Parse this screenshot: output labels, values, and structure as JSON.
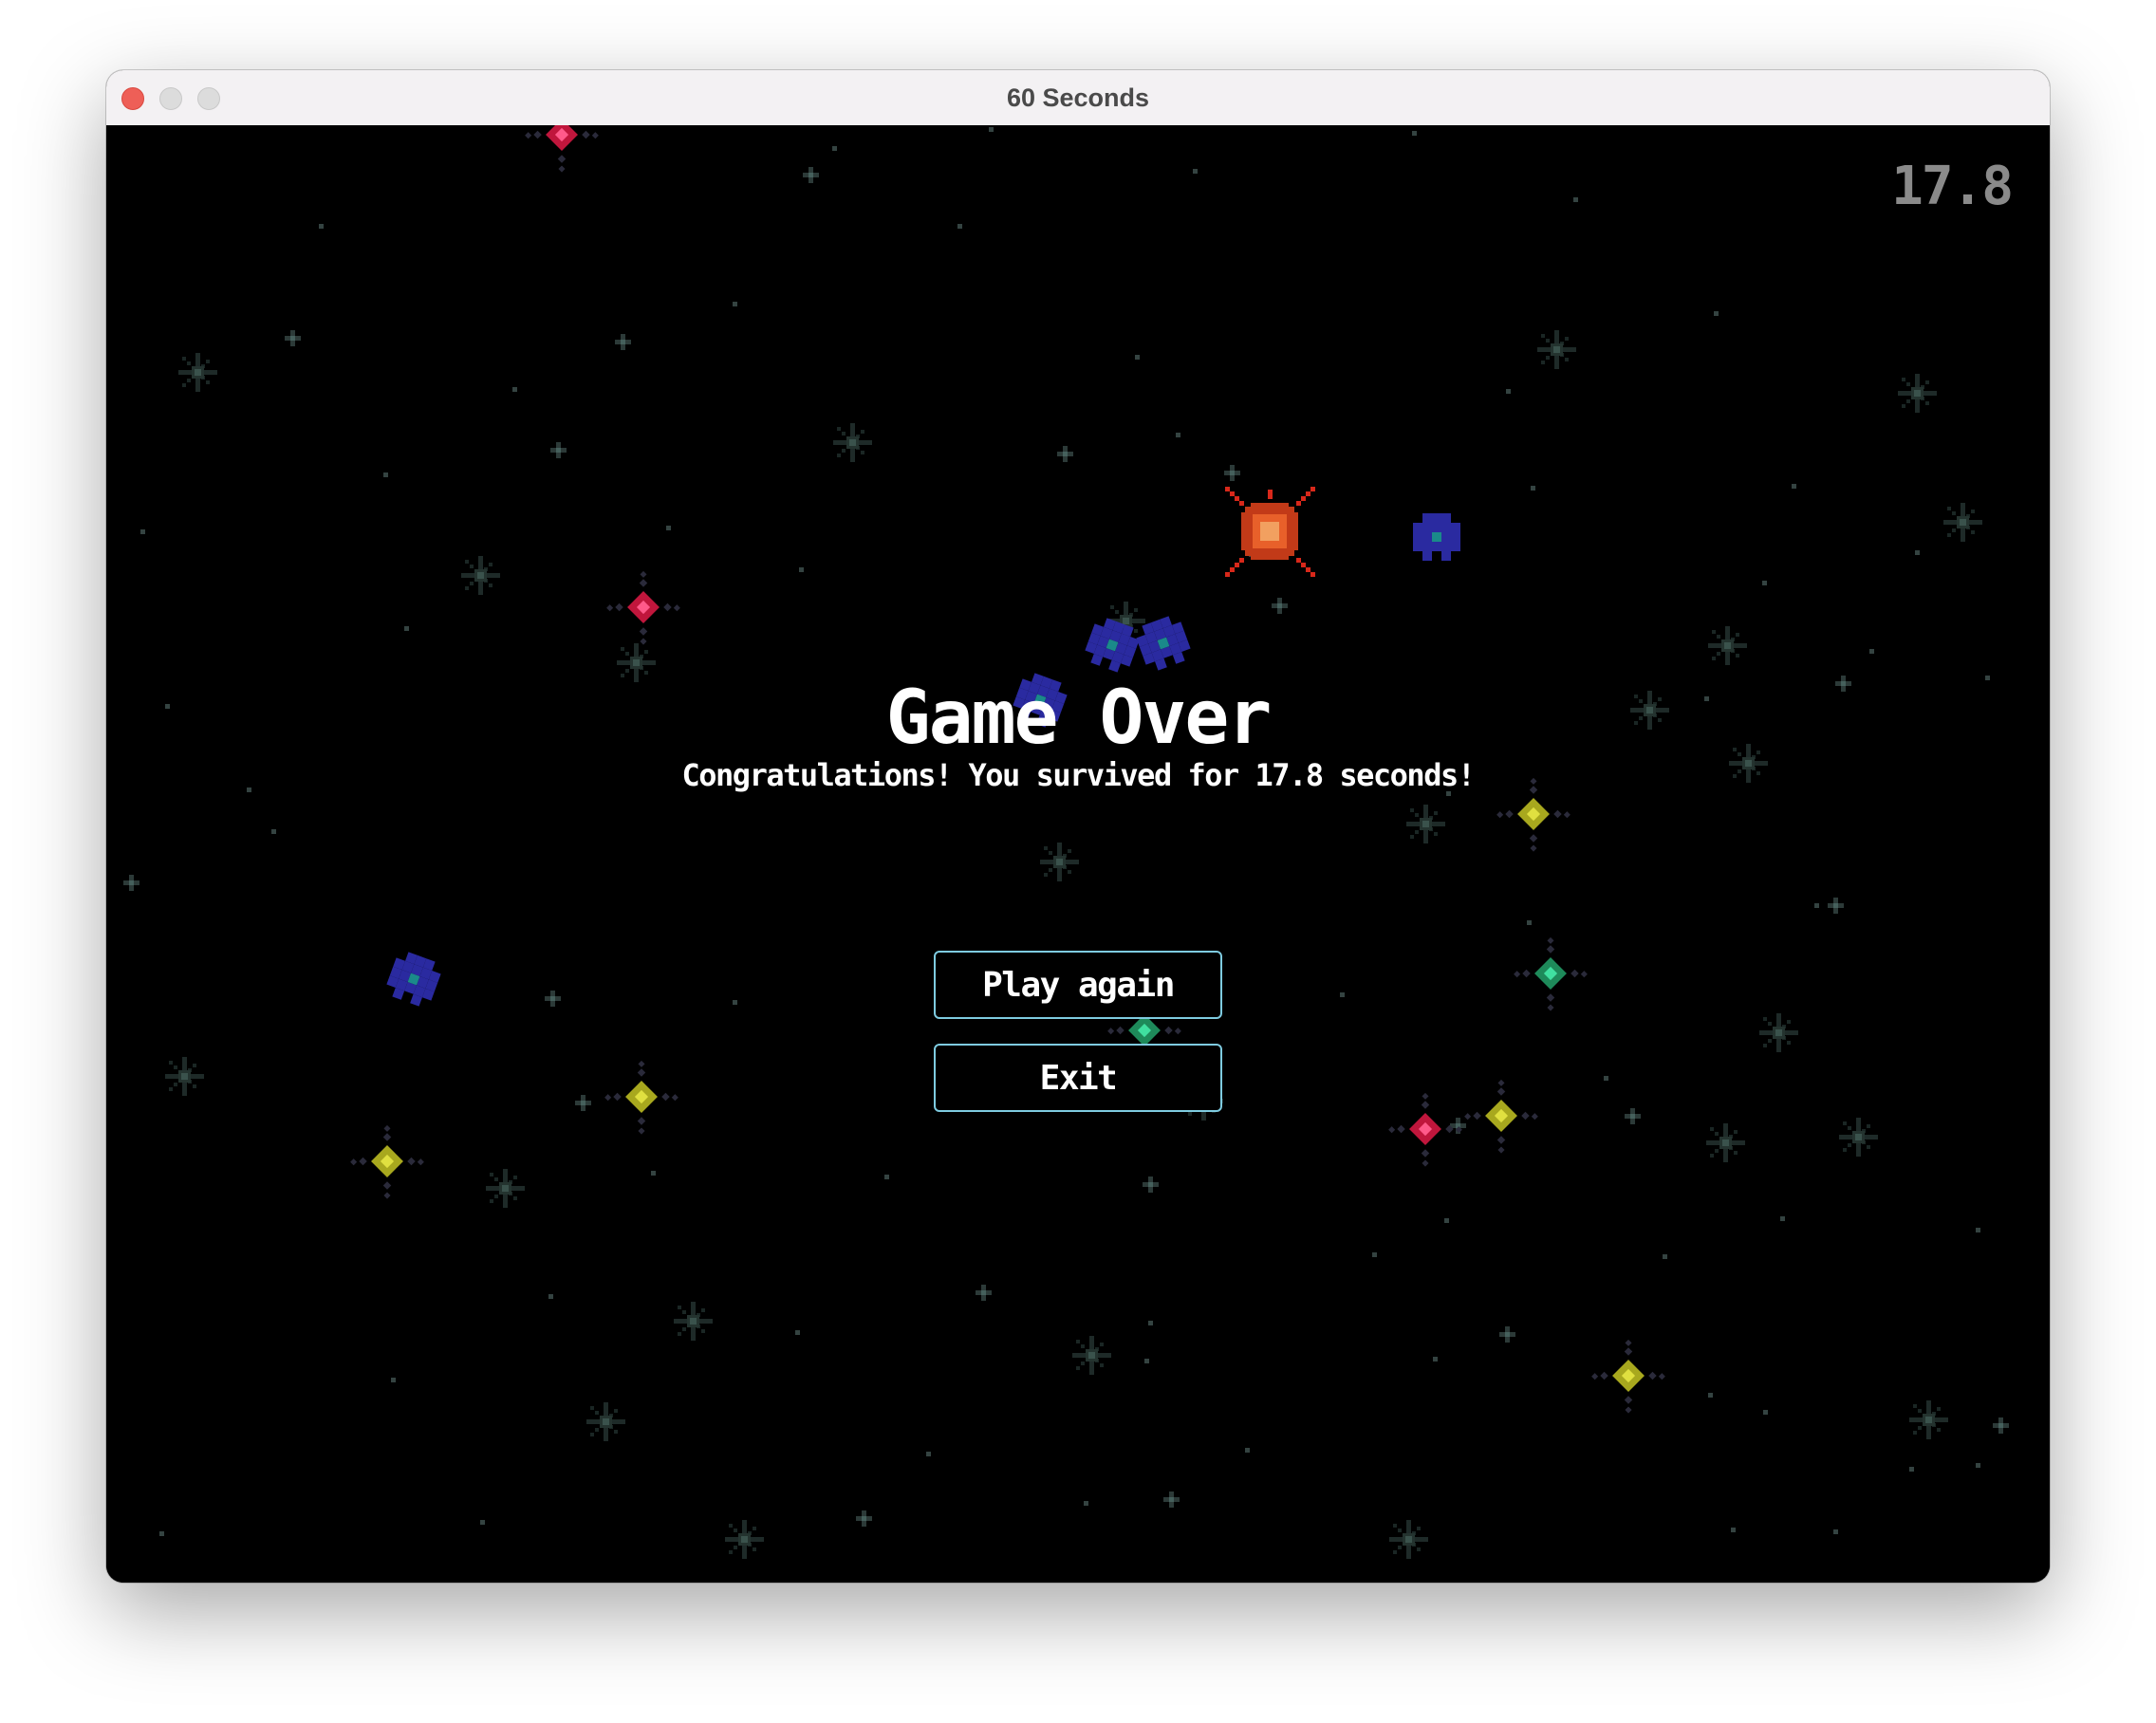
{
  "window": {
    "title": "60 Seconds"
  },
  "hud": {
    "timer": "17.8"
  },
  "overlay": {
    "heading": "Game Over",
    "message": "Congratulations! You survived for 17.8 seconds!"
  },
  "buttons": {
    "play_again": "Play again",
    "exit": "Exit"
  },
  "colors": {
    "background": "#000000",
    "button_border": "#7ecbe0",
    "timer": "#8a8a8a",
    "enemy_blue": "#2a2aa0",
    "enemy_red": "#c0163c",
    "enemy_yellow": "#a8a81e",
    "enemy_green": "#1e8a5a",
    "explosion": "#e8602a"
  },
  "sprites": [
    {
      "kind": "explosion-icon"
    },
    {
      "kind": "blue-invader-icon"
    },
    {
      "kind": "red-mine-icon"
    },
    {
      "kind": "yellow-mine-icon"
    },
    {
      "kind": "green-mine-icon"
    }
  ]
}
